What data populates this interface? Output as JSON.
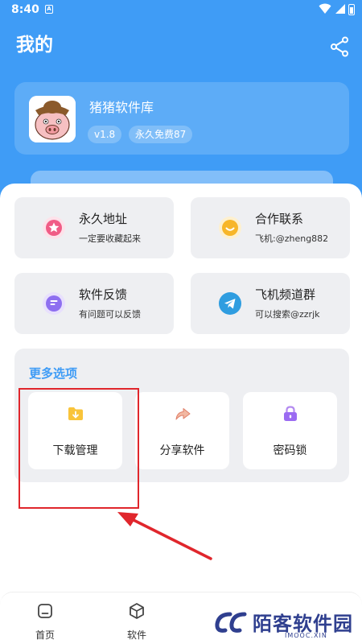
{
  "status_bar": {
    "time": "8:40",
    "notif_glyph": "A"
  },
  "header": {
    "title": "我的"
  },
  "profile": {
    "app_name": "猪猪软件库",
    "version": "v1.8",
    "license": "永久免费87"
  },
  "tiles": [
    {
      "title": "永久地址",
      "subtitle": "一定要收藏起来",
      "icon": "star-icon",
      "color": "#f05c86"
    },
    {
      "title": "合作联系",
      "subtitle": "飞机:@zheng882",
      "icon": "chat-bubble-icon",
      "color": "#f7b629"
    },
    {
      "title": "软件反馈",
      "subtitle": "有问题可以反馈",
      "icon": "feedback-icon",
      "color": "#8e6ff0"
    },
    {
      "title": "飞机频道群",
      "subtitle": "可以搜索@zzrjk",
      "icon": "telegram-icon",
      "color": "#2f9de0"
    }
  ],
  "more_options": {
    "title": "更多选项",
    "items": [
      {
        "label": "下载管理",
        "icon": "download-folder-icon"
      },
      {
        "label": "分享软件",
        "icon": "share-arrow-icon"
      },
      {
        "label": "密码锁",
        "icon": "lock-icon"
      }
    ]
  },
  "bottom_nav": [
    {
      "label": "首页",
      "icon": "home-icon"
    },
    {
      "label": "软件",
      "icon": "software-box-icon"
    }
  ],
  "watermark": {
    "text": "陌客软件园",
    "sub": "IMOOC.XIN"
  },
  "colors": {
    "primary": "#3f9cf6",
    "highlight": "#e0262c"
  }
}
